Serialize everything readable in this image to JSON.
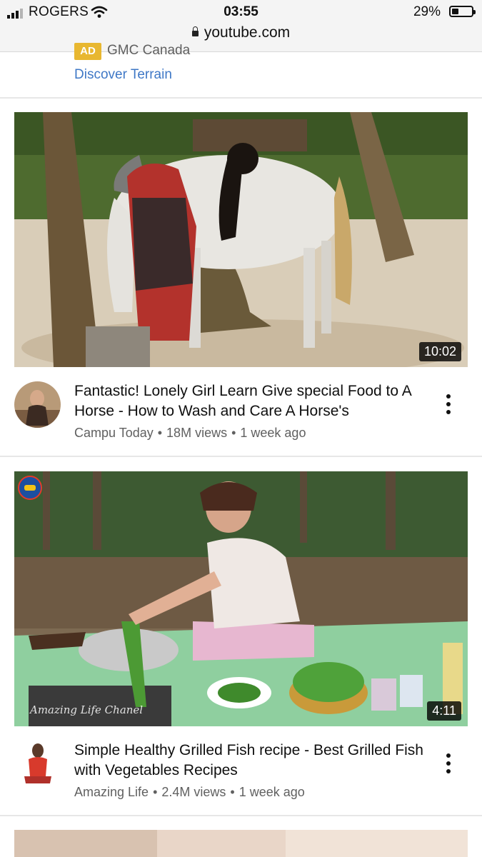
{
  "status_bar": {
    "carrier": "ROGERS",
    "time": "03:55",
    "battery": "29%",
    "battery_level": 0.29,
    "url": "youtube.com"
  },
  "ad": {
    "badge": "AD",
    "advertiser": "GMC Canada",
    "cta": "Discover Terrain"
  },
  "videos": [
    {
      "title": "Fantastic! Lonely Girl Learn Give special Food to A Horse - How to Wash and Care A Horse's",
      "channel": "Campu Today",
      "views": "18M views",
      "age": "1 week ago",
      "duration": "10:02"
    },
    {
      "title": "Simple Healthy Grilled Fish recipe - Best Grilled Fish with Vegetables Recipes",
      "channel": "Amazing Life",
      "views": "2.4M views",
      "age": "1 week ago",
      "duration": "4:11",
      "watermark": "Amazing Life Chanel"
    }
  ],
  "icons": {
    "more": "more-vert-icon",
    "secure": "lock-icon",
    "wifi": "wifi-icon",
    "signal": "signal-icon",
    "battery": "battery-icon"
  },
  "colors": {
    "ad_badge": "#e8b730",
    "link": "#3f78c6",
    "meta_text": "#606060"
  }
}
